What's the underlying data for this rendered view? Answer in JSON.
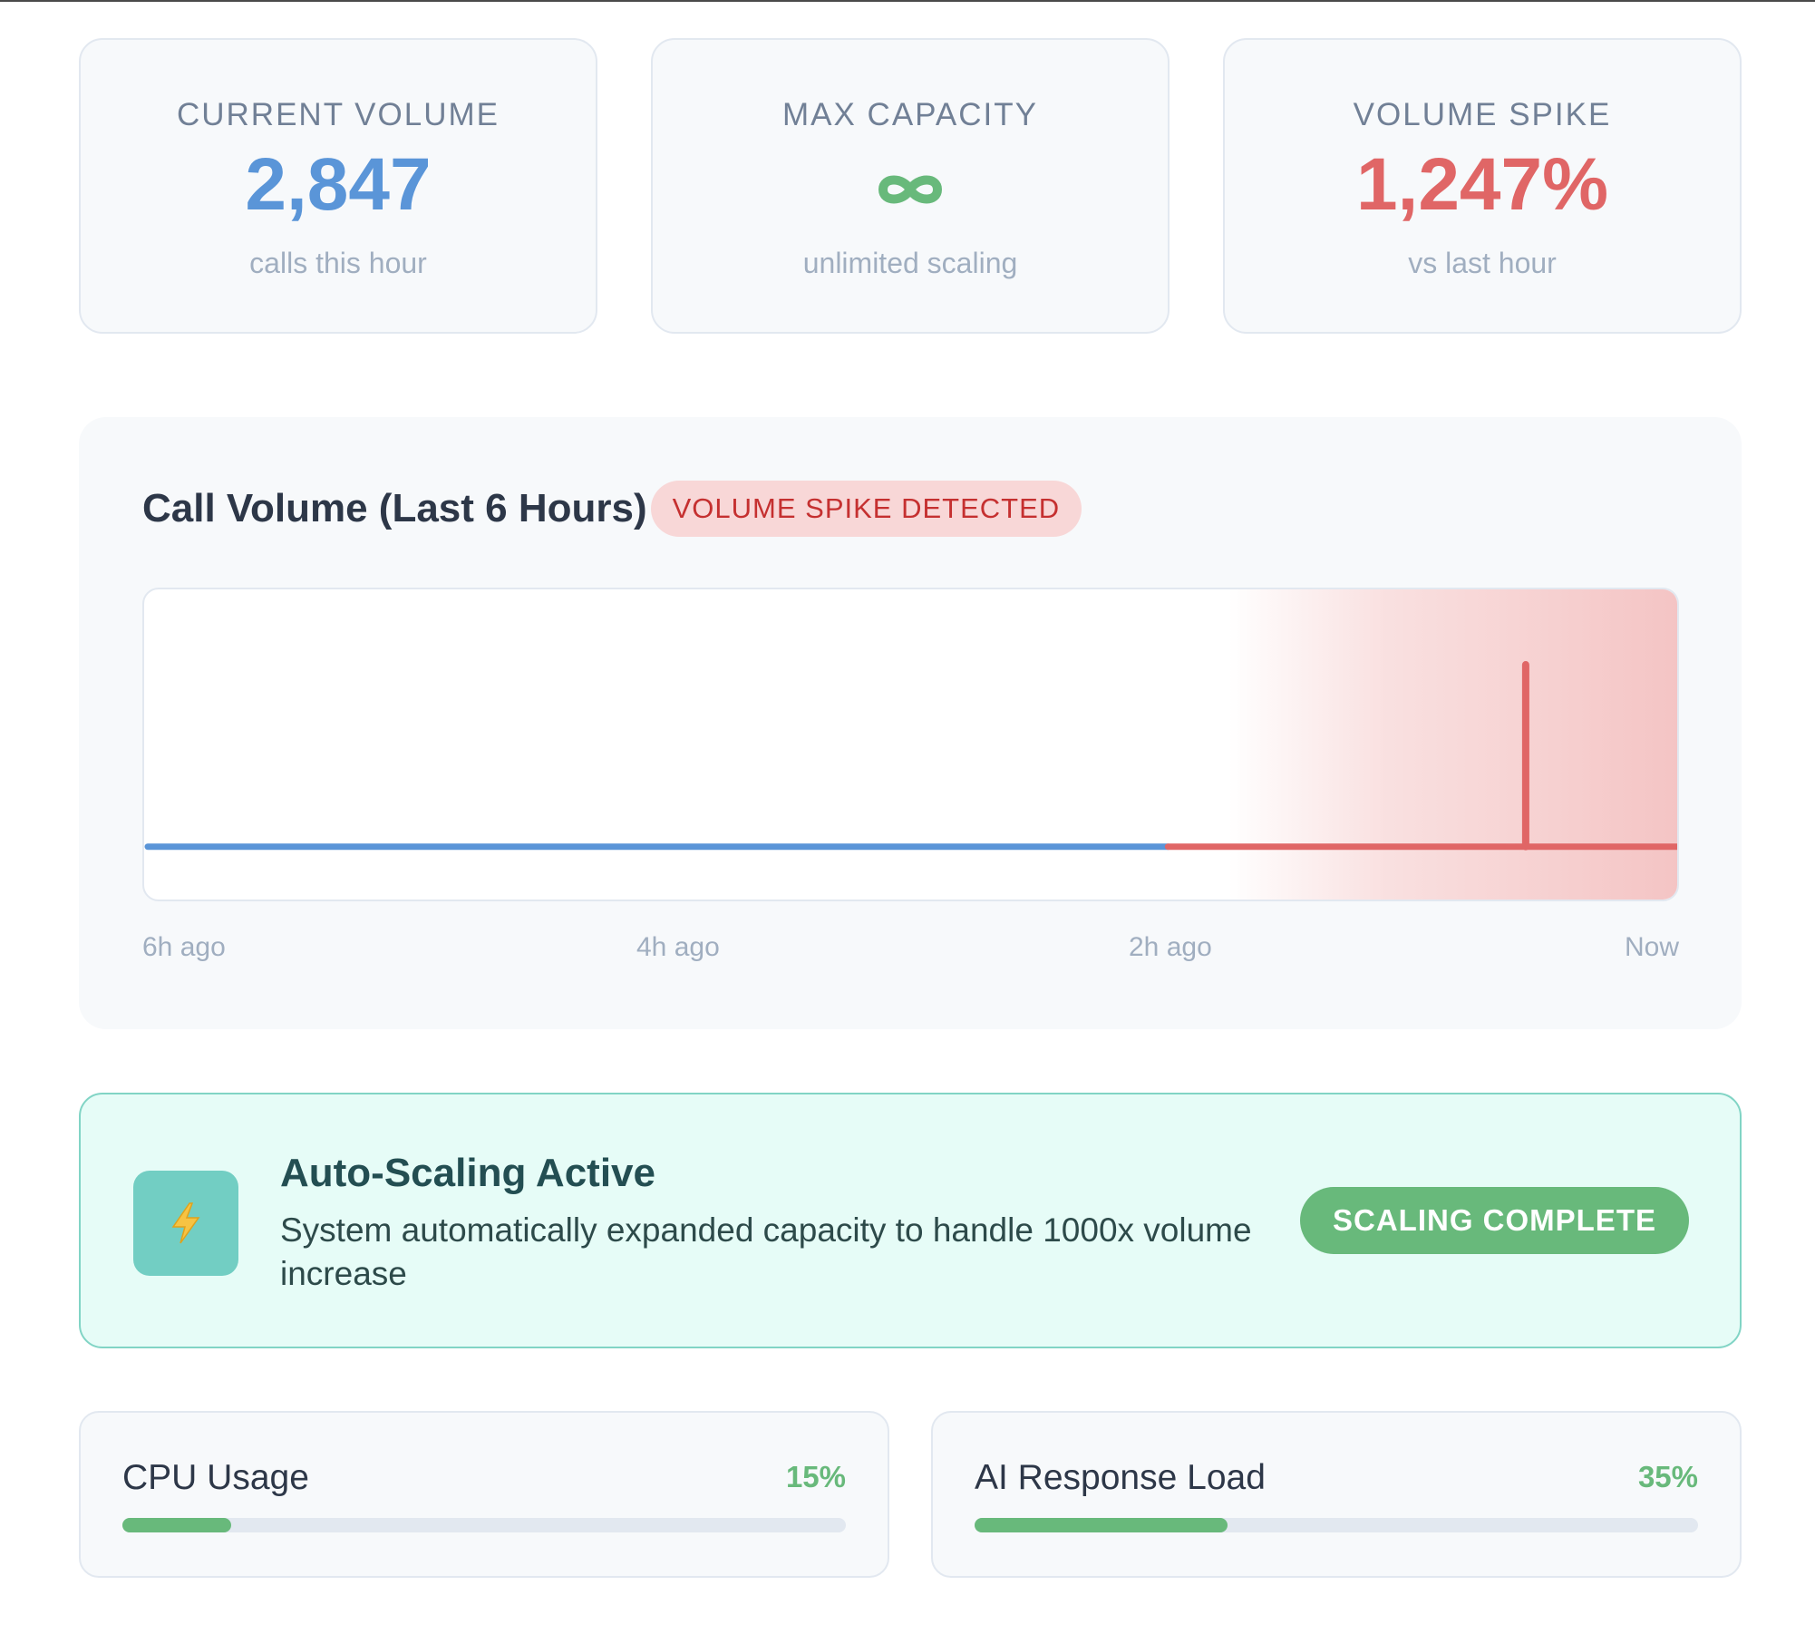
{
  "stats": [
    {
      "label": "CURRENT VOLUME",
      "value": "2,847",
      "sub": "calls this hour",
      "color": "#5a95d8"
    },
    {
      "label": "MAX CAPACITY",
      "value_icon": "infinity-icon",
      "sub": "unlimited scaling",
      "color": "#68b97b"
    },
    {
      "label": "VOLUME SPIKE",
      "value": "1,247%",
      "sub": "vs last hour",
      "color": "#e06666"
    }
  ],
  "chart": {
    "title": "Call Volume (Last 6 Hours)",
    "badge": "VOLUME SPIKE DETECTED",
    "x_labels": [
      "6h ago",
      "4h ago",
      "2h ago",
      "Now"
    ]
  },
  "chart_data": {
    "type": "line",
    "title": "Call Volume (Last 6 Hours)",
    "xlabel": "",
    "ylabel": "",
    "x_ticks": [
      "6h ago",
      "4h ago",
      "2h ago",
      "Now"
    ],
    "series_colors": {
      "normal": "#5a95d8",
      "spike": "#e06666"
    },
    "spike_region_start_hours_ago": 2.0,
    "spike_at_hours_ago": 0.6,
    "baseline_relative": 0.18,
    "spike_relative": 0.76,
    "grid": false
  },
  "banner": {
    "title": "Auto-Scaling Active",
    "text": "System automatically expanded capacity to handle 1000x volume increase",
    "button": "SCALING COMPLETE",
    "icon": "lightning-icon"
  },
  "metrics": [
    {
      "name": "CPU Usage",
      "value": "15%",
      "fraction": 0.15
    },
    {
      "name": "AI Response Load",
      "value": "35%",
      "fraction": 0.35
    }
  ]
}
